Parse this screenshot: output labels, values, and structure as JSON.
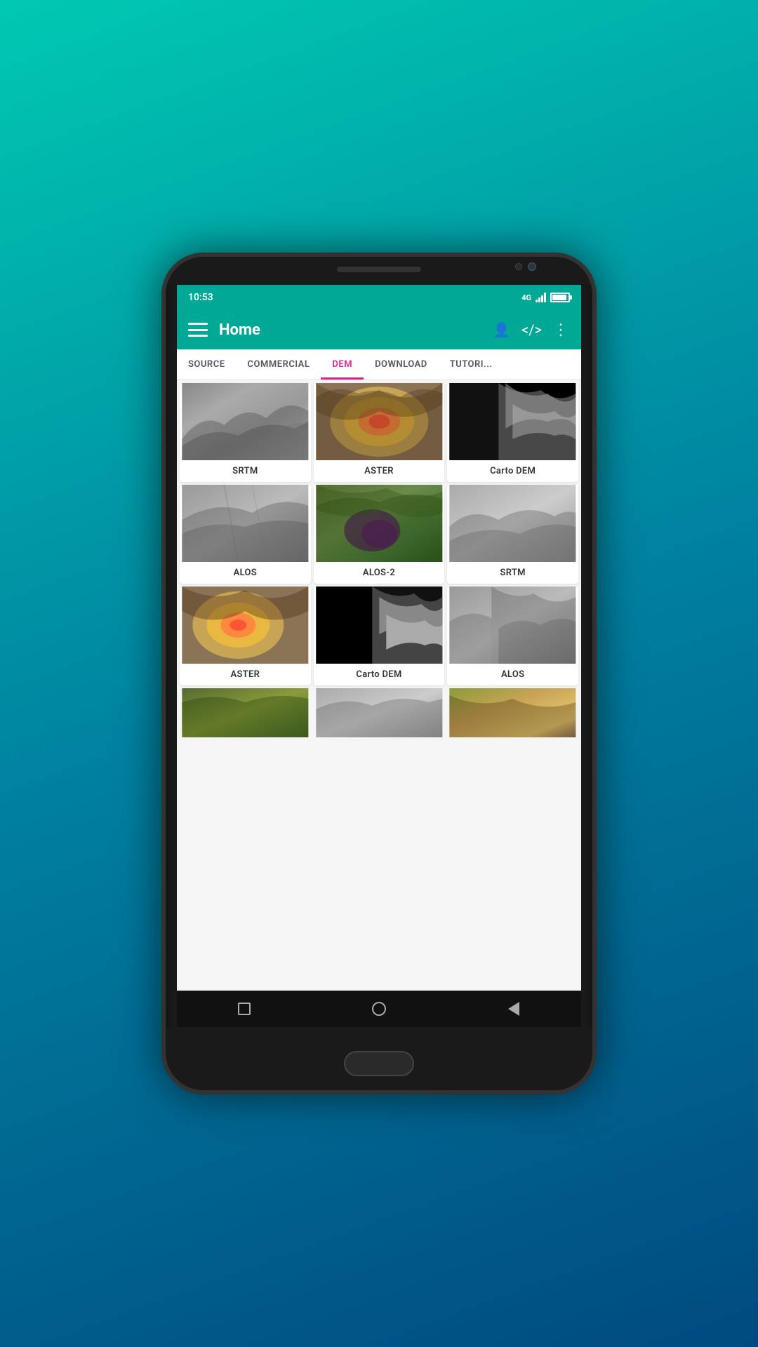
{
  "device": {
    "time": "10:53",
    "signal": "4G",
    "battery": "100"
  },
  "appBar": {
    "title": "Home",
    "menuIcon": "menu-icon",
    "profileIcon": "person-icon",
    "shareIcon": "share-icon",
    "moreIcon": "more-vert-icon"
  },
  "tabs": [
    {
      "id": "source",
      "label": "SOURCE",
      "active": false
    },
    {
      "id": "commercial",
      "label": "COMMERCIAL",
      "active": false
    },
    {
      "id": "dem",
      "label": "DEM",
      "active": true
    },
    {
      "id": "download",
      "label": "DOWNLOAD",
      "active": false
    },
    {
      "id": "tutorial",
      "label": "TUTORI...",
      "active": false
    }
  ],
  "grid": {
    "rows": [
      [
        {
          "id": "srtm-1",
          "label": "SRTM",
          "imageClass": "dem-srtm-1"
        },
        {
          "id": "aster-1",
          "label": "ASTER",
          "imageClass": "dem-aster-1"
        },
        {
          "id": "carto-1",
          "label": "Carto DEM",
          "imageClass": "dem-carto-1"
        }
      ],
      [
        {
          "id": "alos-1",
          "label": "ALOS",
          "imageClass": "dem-alos-1"
        },
        {
          "id": "alos2-1",
          "label": "ALOS-2",
          "imageClass": "dem-alos2-1"
        },
        {
          "id": "srtm-2",
          "label": "SRTM",
          "imageClass": "dem-srtm-2"
        }
      ],
      [
        {
          "id": "aster-2",
          "label": "ASTER",
          "imageClass": "dem-aster-2"
        },
        {
          "id": "carto-2",
          "label": "Carto DEM",
          "imageClass": "dem-carto-2"
        },
        {
          "id": "alos-2",
          "label": "ALOS",
          "imageClass": "dem-alos-2"
        }
      ]
    ],
    "partialRow": [
      {
        "id": "partial-1",
        "imageClass": "dem-green-1"
      },
      {
        "id": "partial-2",
        "imageClass": "dem-tan-1"
      },
      {
        "id": "partial-3",
        "imageClass": "dem-colorful-1"
      }
    ]
  },
  "bottomNav": {
    "squareLabel": "recents-button",
    "circleLabel": "home-button",
    "triangleLabel": "back-button"
  }
}
